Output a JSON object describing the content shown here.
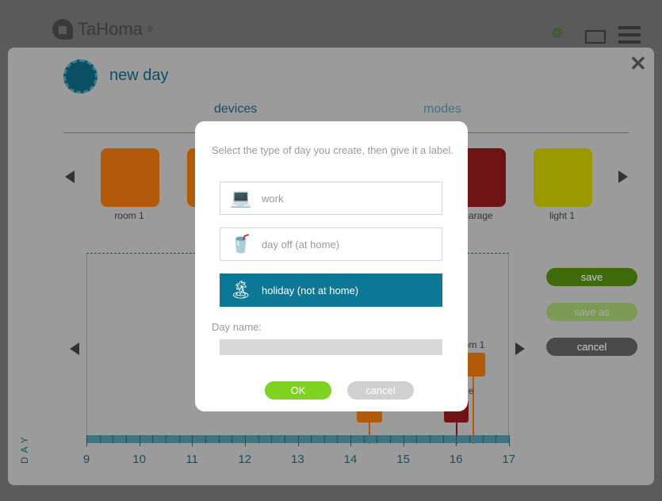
{
  "header": {
    "brand": "TaHoma",
    "brand_mark": "®"
  },
  "page": {
    "title": "new day"
  },
  "tabs": [
    {
      "label": "devices"
    },
    {
      "label": "modes"
    }
  ],
  "devices": [
    {
      "label": "room 1",
      "color": "#b05a0a"
    },
    {
      "label": "",
      "color": "#b05a0a"
    },
    {
      "label": "garage",
      "color": "#6e1414"
    },
    {
      "label": "light 1",
      "color": "#9a9a00"
    }
  ],
  "side_buttons": {
    "save": "save",
    "save_as": "save as",
    "cancel": "cancel"
  },
  "timeline": {
    "axis_label": "DAY",
    "hours": [
      "9",
      "10",
      "11",
      "12",
      "13",
      "14",
      "15",
      "16",
      "17"
    ],
    "markers": [
      {
        "label": "room 1"
      },
      {
        "label": "garage"
      }
    ]
  },
  "modal": {
    "prompt": "Select the type of day you create, then give it a label.",
    "options": [
      {
        "label": "work",
        "icon": "laptop-icon",
        "selected": false
      },
      {
        "label": "day off (at home)",
        "icon": "drink-icon",
        "selected": false
      },
      {
        "label": "holiday (not at home)",
        "icon": "palm-island-icon",
        "selected": true
      }
    ],
    "name_label": "Day name:",
    "name_value": "",
    "ok": "OK",
    "cancel": "cancel"
  },
  "colors": {
    "accent": "#0c7896",
    "ok": "#7ed321",
    "save": "#5a8a10"
  }
}
